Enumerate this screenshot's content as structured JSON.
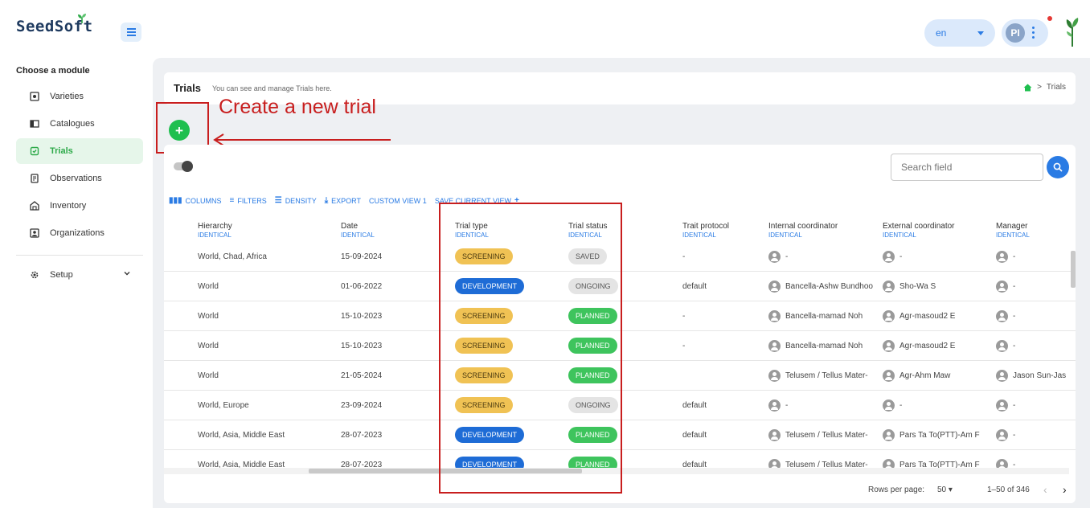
{
  "app": {
    "logo_text": "SeedSoft",
    "brand_green": "#2eaa4a",
    "accent_blue": "#2a7be4"
  },
  "header": {
    "language": "en",
    "user_initials": "PI"
  },
  "sidebar": {
    "title": "Choose a module",
    "items": [
      {
        "label": "Varieties",
        "icon": "variety-icon"
      },
      {
        "label": "Catalogues",
        "icon": "catalogue-icon"
      },
      {
        "label": "Trials",
        "icon": "trials-icon",
        "active": true
      },
      {
        "label": "Observations",
        "icon": "observations-icon"
      },
      {
        "label": "Inventory",
        "icon": "inventory-icon"
      },
      {
        "label": "Organizations",
        "icon": "organizations-icon"
      },
      {
        "label": "Setup",
        "icon": "gear-icon"
      }
    ]
  },
  "page": {
    "title": "Trials",
    "subtitle": "You can see and manage Trials here.",
    "breadcrumb": "Trials"
  },
  "annotation": {
    "text": "Create a new trial",
    "color": "#c81e1e"
  },
  "search": {
    "placeholder": "Search field"
  },
  "toolbar": {
    "columns": "COLUMNS",
    "filters": "FILTERS",
    "density": "DENSITY",
    "export": "EXPORT",
    "custom_view": "CUSTOM VIEW 1",
    "save_view": "SAVE CURRENT VIEW"
  },
  "table": {
    "columns": [
      {
        "label": "Hierarchy",
        "sub": "IDENTICAL"
      },
      {
        "label": "Date",
        "sub": "IDENTICAL"
      },
      {
        "label": "Trial type",
        "sub": "IDENTICAL"
      },
      {
        "label": "Trial status",
        "sub": "IDENTICAL"
      },
      {
        "label": "Trait protocol",
        "sub": "IDENTICAL"
      },
      {
        "label": "Internal coordinator",
        "sub": "IDENTICAL"
      },
      {
        "label": "External coordinator",
        "sub": "IDENTICAL"
      },
      {
        "label": "Manager",
        "sub": "IDENTICAL"
      }
    ],
    "rows": [
      {
        "hierarchy": "World, Chad, Africa",
        "date": "15-09-2024",
        "type": "SCREENING",
        "status": "SAVED",
        "protocol": "-",
        "internal": "-",
        "external": "-",
        "manager": "-"
      },
      {
        "hierarchy": "World",
        "date": "01-06-2022",
        "type": "DEVELOPMENT",
        "status": "ONGOING",
        "protocol": "default",
        "internal": "Bancella-Ashw Bundhoo",
        "external": "Sho-Wa S",
        "manager": "-"
      },
      {
        "hierarchy": "World",
        "date": "15-10-2023",
        "type": "SCREENING",
        "status": "PLANNED",
        "protocol": "-",
        "internal": "Bancella-mamad Noh",
        "external": "Agr-masoud2 E",
        "manager": "-"
      },
      {
        "hierarchy": "World",
        "date": "15-10-2023",
        "type": "SCREENING",
        "status": "PLANNED",
        "protocol": "-",
        "internal": "Bancella-mamad Noh",
        "external": "Agr-masoud2 E",
        "manager": "-"
      },
      {
        "hierarchy": "World",
        "date": "21-05-2024",
        "type": "SCREENING",
        "status": "PLANNED",
        "protocol": "",
        "internal": "Telusem / Tellus Mater-",
        "external": "Agr-Ahm Maw",
        "manager": "Jason Sun-Jas"
      },
      {
        "hierarchy": "World, Europe",
        "date": "23-09-2024",
        "type": "SCREENING",
        "status": "ONGOING",
        "protocol": "default",
        "internal": "-",
        "external": "-",
        "manager": "-"
      },
      {
        "hierarchy": "World, Asia, Middle East",
        "date": "28-07-2023",
        "type": "DEVELOPMENT",
        "status": "PLANNED",
        "protocol": "default",
        "internal": "Telusem / Tellus Mater-",
        "external": "Pars Ta To(PTT)-Am F",
        "manager": "-"
      },
      {
        "hierarchy": "World, Asia, Middle East",
        "date": "28-07-2023",
        "type": "DEVELOPMENT",
        "status": "PLANNED",
        "protocol": "default",
        "internal": "Telusem / Tellus Mater-",
        "external": "Pars Ta To(PTT)-Am F",
        "manager": "-"
      }
    ]
  },
  "pagination": {
    "rows_per_page_label": "Rows per page:",
    "rows_per_page": "50",
    "range": "1–50 of 346"
  }
}
